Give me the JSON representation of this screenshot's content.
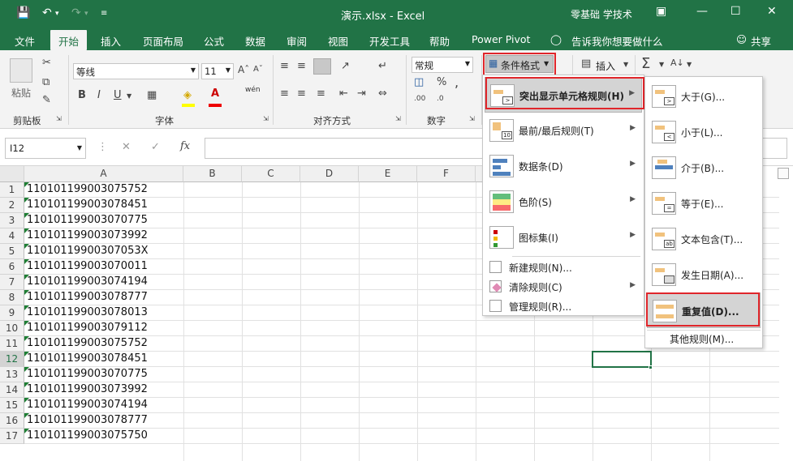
{
  "title": {
    "file": "演示.xlsx - Excel",
    "account": "零基础 学技术"
  },
  "tabs": [
    "文件",
    "开始",
    "插入",
    "页面布局",
    "公式",
    "数据",
    "审阅",
    "视图",
    "开发工具",
    "帮助",
    "Power Pivot",
    "告诉我你想要做什么",
    "共享"
  ],
  "ribbon": {
    "paste": "粘贴",
    "clipboard": "剪贴板",
    "font_name": "等线",
    "font_size": "11",
    "font_group": "字体",
    "bold": "B",
    "italic": "I",
    "underline": "U",
    "align_group": "对齐方式",
    "number_format": "常规",
    "number_group": "数字",
    "cond_format": "条件格式",
    "insert": "插入",
    "wen": "wén"
  },
  "formula_bar": {
    "name_box": "I12",
    "fx": "fx",
    "value": ""
  },
  "columns": [
    "A",
    "B",
    "C",
    "D",
    "E",
    "F"
  ],
  "rows": [
    {
      "n": "1",
      "v": "110101199003075752"
    },
    {
      "n": "2",
      "v": "110101199003078451"
    },
    {
      "n": "3",
      "v": "110101199003070775"
    },
    {
      "n": "4",
      "v": "110101199003073992"
    },
    {
      "n": "5",
      "v": "11010119900307053X"
    },
    {
      "n": "6",
      "v": "110101199003070011"
    },
    {
      "n": "7",
      "v": "110101199003074194"
    },
    {
      "n": "8",
      "v": "110101199003078777"
    },
    {
      "n": "9",
      "v": "110101199003078013"
    },
    {
      "n": "10",
      "v": "110101199003079112"
    },
    {
      "n": "11",
      "v": "110101199003075752"
    },
    {
      "n": "12",
      "v": "110101199003078451"
    },
    {
      "n": "13",
      "v": "110101199003070775"
    },
    {
      "n": "14",
      "v": "110101199003073992"
    },
    {
      "n": "15",
      "v": "110101199003074194"
    },
    {
      "n": "16",
      "v": "110101199003078777"
    },
    {
      "n": "17",
      "v": "110101199003075750"
    }
  ],
  "menu": {
    "items": [
      "突出显示单元格规则(H)",
      "最前/最后规则(T)",
      "数据条(D)",
      "色阶(S)",
      "图标集(I)"
    ],
    "small_items": [
      "新建规则(N)...",
      "清除规则(C)",
      "管理规则(R)..."
    ]
  },
  "submenu": {
    "items": [
      "大于(G)...",
      "小于(L)...",
      "介于(B)...",
      "等于(E)...",
      "文本包含(T)...",
      "发生日期(A)...",
      "重复值(D)..."
    ],
    "more": "其他规则(M)..."
  },
  "colors": {
    "accent": "#217346",
    "highlight": "#e0262b",
    "selected_item": "#d4d4d4"
  }
}
